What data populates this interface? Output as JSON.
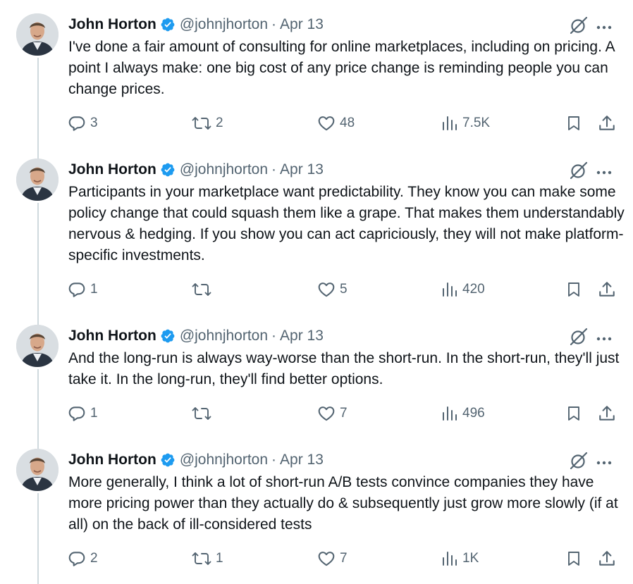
{
  "tweets": [
    {
      "author": {
        "name": "John Horton",
        "handle": "@johnjhorton"
      },
      "sep": "·",
      "date": "Apr 13",
      "text": "I've done a fair amount of consulting for online marketplaces, including on pricing. A point I always make: one big cost of any price change is reminding people you can change prices.",
      "stats": {
        "replies": "3",
        "reposts": "2",
        "likes": "48",
        "views": "7.5K"
      }
    },
    {
      "author": {
        "name": "John Horton",
        "handle": "@johnjhorton"
      },
      "sep": "·",
      "date": "Apr 13",
      "text": "Participants in your marketplace want predictability. They know you can make some policy change that could squash them like a grape. That makes them understandably nervous & hedging. If you show you can act capriciously, they will not make platform-specific investments.",
      "stats": {
        "replies": "1",
        "reposts": "",
        "likes": "5",
        "views": "420"
      }
    },
    {
      "author": {
        "name": "John Horton",
        "handle": "@johnjhorton"
      },
      "sep": "·",
      "date": "Apr 13",
      "text": "And the long-run is always way-worse than the short-run. In the short-run, they'll just take it. In the long-run, they'll find better options.",
      "stats": {
        "replies": "1",
        "reposts": "",
        "likes": "7",
        "views": "496"
      }
    },
    {
      "author": {
        "name": "John Horton",
        "handle": "@johnjhorton"
      },
      "sep": "·",
      "date": "Apr 13",
      "text": "More generally, I think a lot of short-run A/B tests convince companies they have more pricing power than they actually do & subsequently just grow more slowly (if at all) on the back of ill-considered tests",
      "stats": {
        "replies": "2",
        "reposts": "1",
        "likes": "7",
        "views": "1K"
      }
    }
  ],
  "icons": {
    "verified": "verified-badge-icon",
    "grok": "grok-icon",
    "more": "more-icon",
    "reply": "reply-icon",
    "repost": "repost-icon",
    "like": "like-icon",
    "views": "views-icon",
    "bookmark": "bookmark-icon",
    "share": "share-icon"
  },
  "colors": {
    "text": "#0f1419",
    "secondary": "#536471",
    "verified": "#1d9bf0",
    "thread_line": "#cfd9de"
  }
}
